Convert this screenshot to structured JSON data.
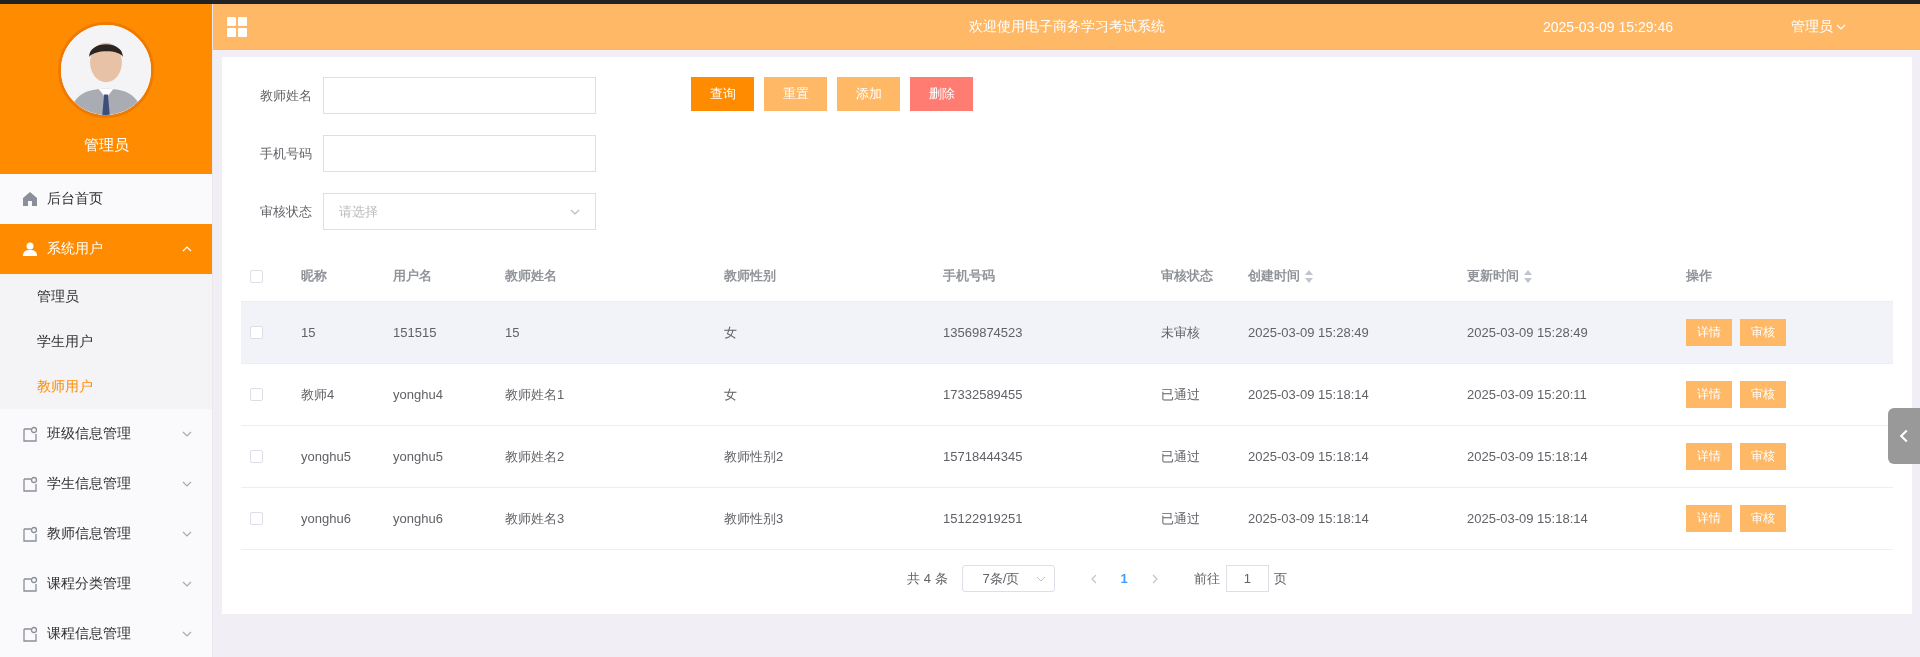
{
  "header": {
    "title": "欢迎使用电子商务学习考试系统",
    "datetime": "2025-03-09 15:29:46",
    "user": "管理员"
  },
  "sidebar": {
    "user_name": "管理员",
    "items": [
      {
        "label": "后台首页",
        "kind": "home",
        "selected": false
      },
      {
        "label": "系统用户",
        "kind": "user",
        "selected": true,
        "expanded": true,
        "children": [
          {
            "label": "管理员",
            "selected": false
          },
          {
            "label": "学生用户",
            "selected": false
          },
          {
            "label": "教师用户",
            "selected": true
          }
        ]
      },
      {
        "label": "班级信息管理",
        "kind": "doc",
        "selected": false,
        "expanded": false
      },
      {
        "label": "学生信息管理",
        "kind": "doc",
        "selected": false,
        "expanded": false
      },
      {
        "label": "教师信息管理",
        "kind": "doc",
        "selected": false,
        "expanded": false
      },
      {
        "label": "课程分类管理",
        "kind": "doc",
        "selected": false,
        "expanded": false
      },
      {
        "label": "课程信息管理",
        "kind": "doc",
        "selected": false,
        "expanded": false
      }
    ]
  },
  "filters": [
    {
      "label": "教师姓名",
      "kind": "text"
    },
    {
      "label": "手机号码",
      "kind": "text"
    },
    {
      "label": "审核状态",
      "kind": "select",
      "placeholder": "请选择"
    }
  ],
  "buttons": [
    {
      "label": "查询",
      "kind": "primary"
    },
    {
      "label": "重置",
      "kind": "secondary"
    },
    {
      "label": "添加",
      "kind": "secondary"
    },
    {
      "label": "删除",
      "kind": "danger"
    }
  ],
  "table": {
    "select_all_checked": false,
    "columns": [
      {
        "label": "昵称",
        "sortable": false
      },
      {
        "label": "用户名",
        "sortable": false
      },
      {
        "label": "教师姓名",
        "sortable": false
      },
      {
        "label": "教师性别",
        "sortable": false
      },
      {
        "label": "手机号码",
        "sortable": false
      },
      {
        "label": "审核状态",
        "sortable": false
      },
      {
        "label": "创建时间",
        "sortable": true
      },
      {
        "label": "更新时间",
        "sortable": true
      },
      {
        "label": "操作",
        "sortable": false
      }
    ],
    "rows": [
      {
        "checked": false,
        "highlighted": true,
        "cells": [
          "15",
          "151515",
          "15",
          "女",
          "13569874523",
          "未审核",
          "2025-03-09 15:28:49",
          "2025-03-09 15:28:49"
        ],
        "actions": [
          "详情",
          "审核"
        ]
      },
      {
        "checked": false,
        "highlighted": false,
        "cells": [
          "教师4",
          "yonghu4",
          "教师姓名1",
          "女",
          "17332589455",
          "已通过",
          "2025-03-09 15:18:14",
          "2025-03-09 15:20:11"
        ],
        "actions": [
          "详情",
          "审核"
        ]
      },
      {
        "checked": false,
        "highlighted": false,
        "cells": [
          "yonghu5",
          "yonghu5",
          "教师姓名2",
          "教师性别2",
          "15718444345",
          "已通过",
          "2025-03-09 15:18:14",
          "2025-03-09 15:18:14"
        ],
        "actions": [
          "详情",
          "审核"
        ]
      },
      {
        "checked": false,
        "highlighted": false,
        "cells": [
          "yonghu6",
          "yonghu6",
          "教师姓名3",
          "教师性别3",
          "15122919251",
          "已通过",
          "2025-03-09 15:18:14",
          "2025-03-09 15:18:14"
        ],
        "actions": [
          "详情",
          "审核"
        ]
      }
    ]
  },
  "pagination": {
    "total": "共 4 条",
    "page_size": "7条/页",
    "pages": [
      {
        "label": "1",
        "selected": true
      }
    ],
    "goto_label": "前往",
    "goto_value": "1",
    "page_suffix": "页"
  }
}
